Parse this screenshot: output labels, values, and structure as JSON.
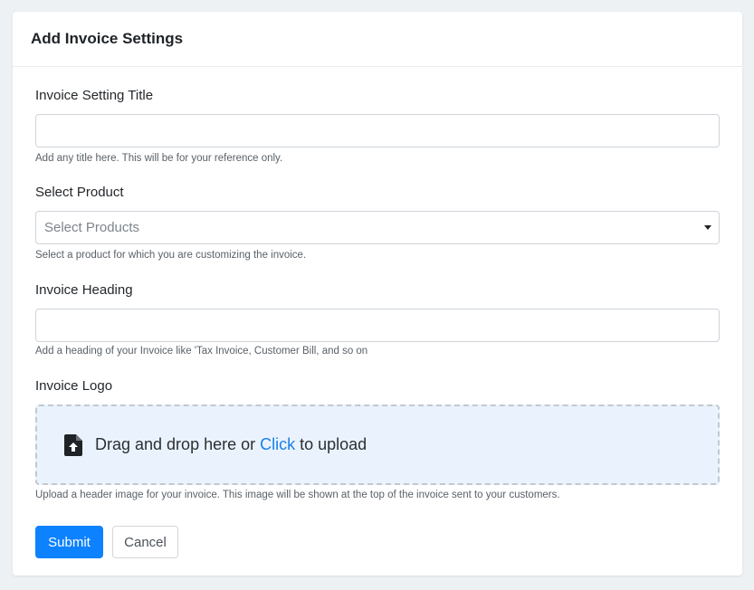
{
  "header": {
    "title": "Add Invoice Settings"
  },
  "fields": {
    "title": {
      "label": "Invoice Setting Title",
      "value": "",
      "help": "Add any title here. This will be for your reference only."
    },
    "product": {
      "label": "Select Product",
      "placeholder": "Select Products",
      "help": "Select a product for which you are customizing the invoice."
    },
    "heading": {
      "label": "Invoice Heading",
      "value": "",
      "help": "Add a heading of your Invoice like 'Tax Invoice, Customer Bill, and so on"
    },
    "logo": {
      "label": "Invoice Logo",
      "drop_text_before": "Drag and drop here or ",
      "drop_link": "Click",
      "drop_text_after": " to upload",
      "help": "Upload a header image for your invoice. This image will be shown at the top of the invoice sent to your customers."
    }
  },
  "actions": {
    "submit_label": "Submit",
    "cancel_label": "Cancel"
  },
  "colors": {
    "primary": "#0d82ff",
    "link": "#1a7fe8",
    "dropzone_bg": "#eaf3fd"
  },
  "icons": {
    "upload": "file-upload-icon",
    "dropdown": "caret-down-icon"
  }
}
